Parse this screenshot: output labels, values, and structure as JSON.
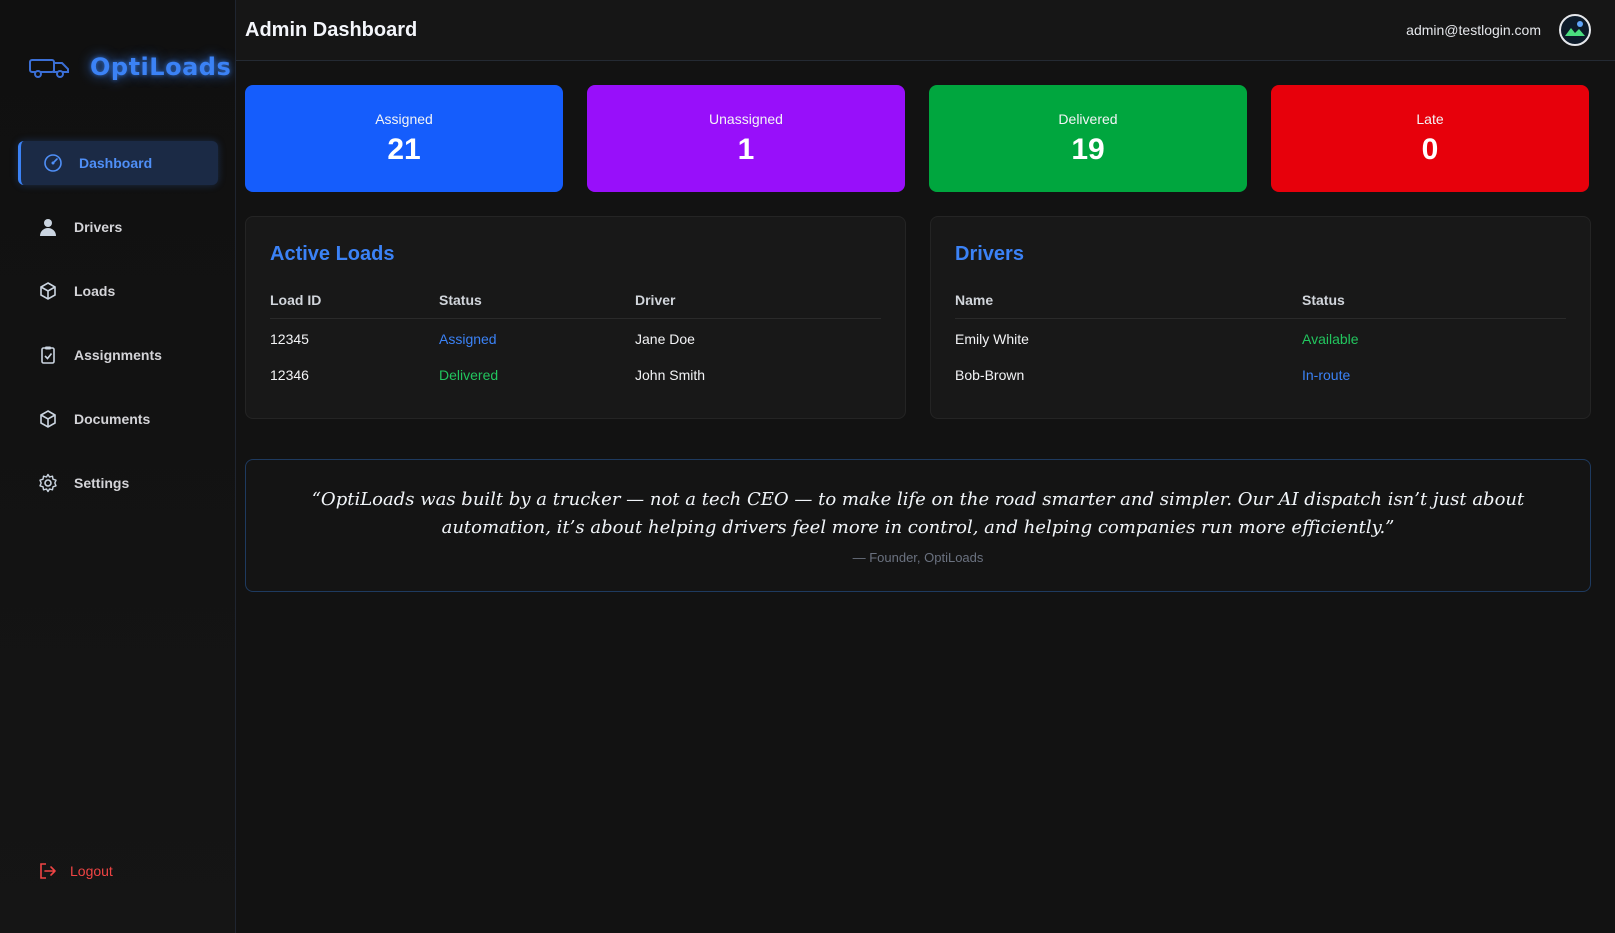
{
  "brand": {
    "name": "OptiLoads",
    "icon": "truck-icon"
  },
  "sidebar": {
    "items": [
      {
        "label": "Dashboard",
        "icon": "gauge-icon",
        "active": true
      },
      {
        "label": "Drivers",
        "icon": "user-icon"
      },
      {
        "label": "Loads",
        "icon": "box-icon"
      },
      {
        "label": "Assignments",
        "icon": "clipboard-check-icon"
      },
      {
        "label": "Documents",
        "icon": "box-icon"
      },
      {
        "label": "Settings",
        "icon": "gear-icon"
      }
    ],
    "logout_label": "Logout"
  },
  "header": {
    "title": "Admin Dashboard",
    "user_email": "admin@testlogin.com"
  },
  "stats": [
    {
      "label": "Assigned",
      "value": "21",
      "color": "#155dfc"
    },
    {
      "label": "Unassigned",
      "value": "1",
      "color": "#980ffa"
    },
    {
      "label": "Delivered",
      "value": "19",
      "color": "#00a63e"
    },
    {
      "label": "Late",
      "value": "0",
      "color": "#e7000b"
    }
  ],
  "active_loads": {
    "title": "Active Loads",
    "columns": [
      "Load ID",
      "Status",
      "Driver"
    ],
    "rows": [
      {
        "id": "12345",
        "status": "Assigned",
        "driver": "Jane Doe"
      },
      {
        "id": "12346",
        "status": "Delivered",
        "driver": "John Smith"
      }
    ]
  },
  "drivers": {
    "title": "Drivers",
    "columns": [
      "Name",
      "Status"
    ],
    "rows": [
      {
        "name": "Emily White",
        "status": "Available"
      },
      {
        "name": "Bob-Brown",
        "status": "In-route"
      }
    ]
  },
  "quote": {
    "text": "“OptiLoads was built by a trucker — not a tech CEO — to make life on the road smarter and simpler. Our AI dispatch isn’t just about automation, it’s about helping drivers feel more in control, and helping companies run more efficiently.”",
    "author": "— Founder, OptiLoads"
  },
  "colors": {
    "accent": "#3b82f6",
    "success": "#22c55e",
    "danger": "#ef4444"
  }
}
